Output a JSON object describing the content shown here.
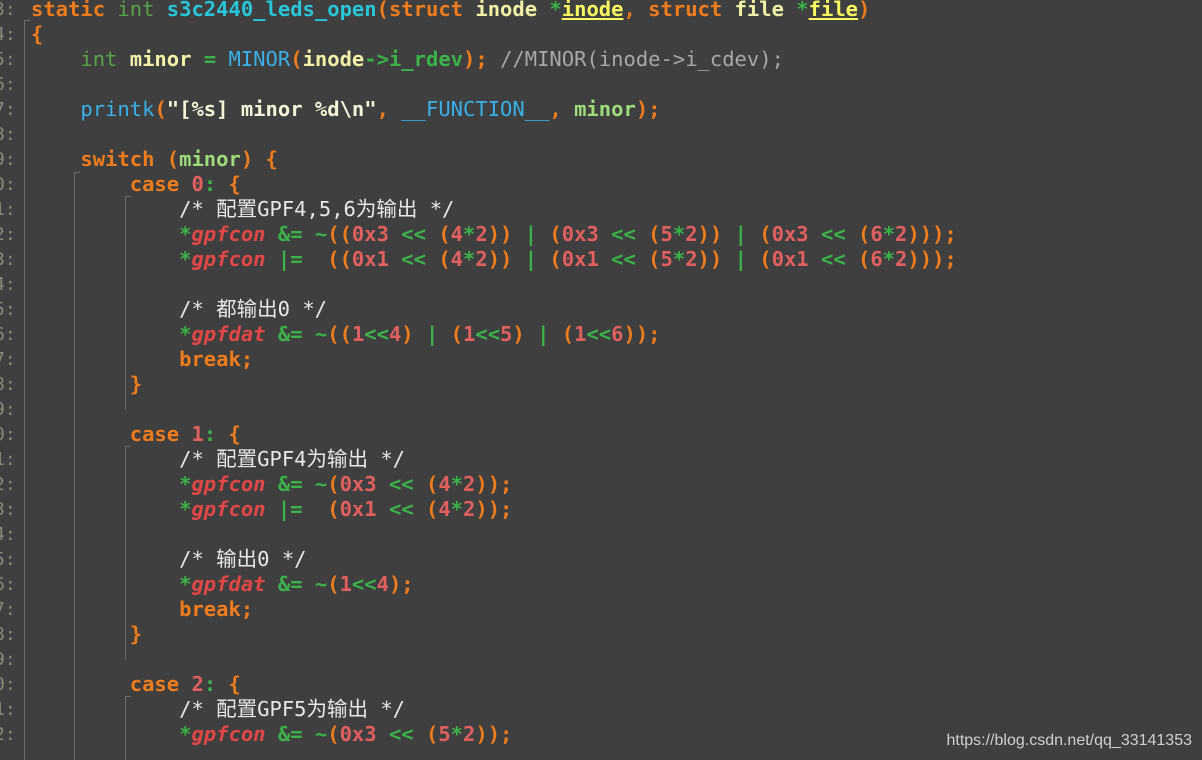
{
  "editor": {
    "line_numbers": [
      "3:",
      "4:",
      "5:",
      "6:",
      "7:",
      "8:",
      "9:",
      "0:",
      "1:",
      "2:",
      "3:",
      "4:",
      "5:",
      "6:",
      "7:",
      "8:",
      "9:",
      "0:",
      "1:",
      "2:",
      "3:",
      "4:",
      "5:",
      "6:",
      "7:",
      "8:",
      "9:",
      "0:",
      "1:",
      "2:"
    ],
    "lines": [
      [
        [
          "kw",
          "static"
        ],
        [
          "plain",
          " "
        ],
        [
          "type",
          "int"
        ],
        [
          "plain",
          " "
        ],
        [
          "fn",
          "s3c2440_leds_open"
        ],
        [
          "punc",
          "("
        ],
        [
          "kw",
          "struct"
        ],
        [
          "plain",
          " "
        ],
        [
          "ident",
          "inode"
        ],
        [
          "plain",
          " "
        ],
        [
          "green",
          "*"
        ],
        [
          "ul",
          "inode"
        ],
        [
          "punc",
          ", "
        ],
        [
          "kw",
          "struct"
        ],
        [
          "plain",
          " "
        ],
        [
          "ident",
          "file"
        ],
        [
          "plain",
          " "
        ],
        [
          "green",
          "*"
        ],
        [
          "ul",
          "file"
        ],
        [
          "punc",
          ")"
        ]
      ],
      [
        [
          "punc",
          "{"
        ]
      ],
      [
        [
          "plain",
          "    "
        ],
        [
          "type",
          "int"
        ],
        [
          "plain",
          " "
        ],
        [
          "ident",
          "minor"
        ],
        [
          "plain",
          " "
        ],
        [
          "green",
          "="
        ],
        [
          "plain",
          " "
        ],
        [
          "macro",
          "MINOR"
        ],
        [
          "punc",
          "("
        ],
        [
          "ident",
          "inode"
        ],
        [
          "green",
          "->"
        ],
        [
          "green",
          "i_rdev"
        ],
        [
          "punc",
          ");"
        ],
        [
          "plain",
          " "
        ],
        [
          "comment",
          "//MINOR(inode->i_cdev);"
        ]
      ],
      [],
      [
        [
          "plain",
          "    "
        ],
        [
          "macro",
          "printk"
        ],
        [
          "punc",
          "("
        ],
        [
          "str",
          "\"[%s] minor %d\\n\""
        ],
        [
          "punc",
          ", "
        ],
        [
          "macro",
          "__FUNCTION__"
        ],
        [
          "punc",
          ", "
        ],
        [
          "fnc",
          "minor"
        ],
        [
          "punc",
          ");"
        ]
      ],
      [],
      [
        [
          "plain",
          "    "
        ],
        [
          "kw",
          "switch"
        ],
        [
          "plain",
          " "
        ],
        [
          "punc",
          "("
        ],
        [
          "fnc",
          "minor"
        ],
        [
          "punc",
          ")"
        ],
        [
          "plain",
          " "
        ],
        [
          "punc",
          "{"
        ]
      ],
      [
        [
          "plain",
          "        "
        ],
        [
          "kw",
          "case"
        ],
        [
          "plain",
          " "
        ],
        [
          "num",
          "0"
        ],
        [
          "green",
          ":"
        ],
        [
          "plain",
          " "
        ],
        [
          "punc",
          "{"
        ]
      ],
      [
        [
          "plain",
          "            "
        ],
        [
          "comment-w",
          "/* 配置GPF4,5,6为输出 */"
        ]
      ],
      [
        [
          "plain",
          "            "
        ],
        [
          "green",
          "*"
        ],
        [
          "var",
          "gpfcon"
        ],
        [
          "plain",
          " "
        ],
        [
          "green",
          "&="
        ],
        [
          "plain",
          " "
        ],
        [
          "green",
          "~"
        ],
        [
          "punc",
          "(("
        ],
        [
          "num",
          "0x3"
        ],
        [
          "plain",
          " "
        ],
        [
          "green",
          "<<"
        ],
        [
          "plain",
          " "
        ],
        [
          "punc",
          "("
        ],
        [
          "num",
          "4"
        ],
        [
          "green",
          "*"
        ],
        [
          "num",
          "2"
        ],
        [
          "punc",
          "))"
        ],
        [
          "plain",
          " "
        ],
        [
          "green",
          "|"
        ],
        [
          "plain",
          " "
        ],
        [
          "punc",
          "("
        ],
        [
          "num",
          "0x3"
        ],
        [
          "plain",
          " "
        ],
        [
          "green",
          "<<"
        ],
        [
          "plain",
          " "
        ],
        [
          "punc",
          "("
        ],
        [
          "num",
          "5"
        ],
        [
          "green",
          "*"
        ],
        [
          "num",
          "2"
        ],
        [
          "punc",
          "))"
        ],
        [
          "plain",
          " "
        ],
        [
          "green",
          "|"
        ],
        [
          "plain",
          " "
        ],
        [
          "punc",
          "("
        ],
        [
          "num",
          "0x3"
        ],
        [
          "plain",
          " "
        ],
        [
          "green",
          "<<"
        ],
        [
          "plain",
          " "
        ],
        [
          "punc",
          "("
        ],
        [
          "num",
          "6"
        ],
        [
          "green",
          "*"
        ],
        [
          "num",
          "2"
        ],
        [
          "punc",
          ")));"
        ]
      ],
      [
        [
          "plain",
          "            "
        ],
        [
          "green",
          "*"
        ],
        [
          "var",
          "gpfcon"
        ],
        [
          "plain",
          " "
        ],
        [
          "green",
          "|="
        ],
        [
          "plain",
          "  "
        ],
        [
          "punc",
          "(("
        ],
        [
          "num",
          "0x1"
        ],
        [
          "plain",
          " "
        ],
        [
          "green",
          "<<"
        ],
        [
          "plain",
          " "
        ],
        [
          "punc",
          "("
        ],
        [
          "num",
          "4"
        ],
        [
          "green",
          "*"
        ],
        [
          "num",
          "2"
        ],
        [
          "punc",
          "))"
        ],
        [
          "plain",
          " "
        ],
        [
          "green",
          "|"
        ],
        [
          "plain",
          " "
        ],
        [
          "punc",
          "("
        ],
        [
          "num",
          "0x1"
        ],
        [
          "plain",
          " "
        ],
        [
          "green",
          "<<"
        ],
        [
          "plain",
          " "
        ],
        [
          "punc",
          "("
        ],
        [
          "num",
          "5"
        ],
        [
          "green",
          "*"
        ],
        [
          "num",
          "2"
        ],
        [
          "punc",
          "))"
        ],
        [
          "plain",
          " "
        ],
        [
          "green",
          "|"
        ],
        [
          "plain",
          " "
        ],
        [
          "punc",
          "("
        ],
        [
          "num",
          "0x1"
        ],
        [
          "plain",
          " "
        ],
        [
          "green",
          "<<"
        ],
        [
          "plain",
          " "
        ],
        [
          "punc",
          "("
        ],
        [
          "num",
          "6"
        ],
        [
          "green",
          "*"
        ],
        [
          "num",
          "2"
        ],
        [
          "punc",
          ")));"
        ]
      ],
      [],
      [
        [
          "plain",
          "            "
        ],
        [
          "comment-w",
          "/* 都输出0 */"
        ]
      ],
      [
        [
          "plain",
          "            "
        ],
        [
          "green",
          "*"
        ],
        [
          "var",
          "gpfdat"
        ],
        [
          "plain",
          " "
        ],
        [
          "green",
          "&="
        ],
        [
          "plain",
          " "
        ],
        [
          "green",
          "~"
        ],
        [
          "punc",
          "(("
        ],
        [
          "num",
          "1"
        ],
        [
          "green",
          "<<"
        ],
        [
          "num",
          "4"
        ],
        [
          "punc",
          ")"
        ],
        [
          "plain",
          " "
        ],
        [
          "green",
          "|"
        ],
        [
          "plain",
          " "
        ],
        [
          "punc",
          "("
        ],
        [
          "num",
          "1"
        ],
        [
          "green",
          "<<"
        ],
        [
          "num",
          "5"
        ],
        [
          "punc",
          ")"
        ],
        [
          "plain",
          " "
        ],
        [
          "green",
          "|"
        ],
        [
          "plain",
          " "
        ],
        [
          "punc",
          "("
        ],
        [
          "num",
          "1"
        ],
        [
          "green",
          "<<"
        ],
        [
          "num",
          "6"
        ],
        [
          "punc",
          "));"
        ]
      ],
      [
        [
          "plain",
          "            "
        ],
        [
          "kw",
          "break"
        ],
        [
          "punc",
          ";"
        ]
      ],
      [
        [
          "plain",
          "        "
        ],
        [
          "punc",
          "}"
        ]
      ],
      [],
      [
        [
          "plain",
          "        "
        ],
        [
          "kw",
          "case"
        ],
        [
          "plain",
          " "
        ],
        [
          "num",
          "1"
        ],
        [
          "green",
          ":"
        ],
        [
          "plain",
          " "
        ],
        [
          "punc",
          "{"
        ]
      ],
      [
        [
          "plain",
          "            "
        ],
        [
          "comment-w",
          "/* 配置GPF4为输出 */"
        ]
      ],
      [
        [
          "plain",
          "            "
        ],
        [
          "green",
          "*"
        ],
        [
          "var",
          "gpfcon"
        ],
        [
          "plain",
          " "
        ],
        [
          "green",
          "&="
        ],
        [
          "plain",
          " "
        ],
        [
          "green",
          "~"
        ],
        [
          "punc",
          "("
        ],
        [
          "num",
          "0x3"
        ],
        [
          "plain",
          " "
        ],
        [
          "green",
          "<<"
        ],
        [
          "plain",
          " "
        ],
        [
          "punc",
          "("
        ],
        [
          "num",
          "4"
        ],
        [
          "green",
          "*"
        ],
        [
          "num",
          "2"
        ],
        [
          "punc",
          "));"
        ]
      ],
      [
        [
          "plain",
          "            "
        ],
        [
          "green",
          "*"
        ],
        [
          "var",
          "gpfcon"
        ],
        [
          "plain",
          " "
        ],
        [
          "green",
          "|="
        ],
        [
          "plain",
          "  "
        ],
        [
          "punc",
          "("
        ],
        [
          "num",
          "0x1"
        ],
        [
          "plain",
          " "
        ],
        [
          "green",
          "<<"
        ],
        [
          "plain",
          " "
        ],
        [
          "punc",
          "("
        ],
        [
          "num",
          "4"
        ],
        [
          "green",
          "*"
        ],
        [
          "num",
          "2"
        ],
        [
          "punc",
          "));"
        ]
      ],
      [],
      [
        [
          "plain",
          "            "
        ],
        [
          "comment-w",
          "/* 输出0 */"
        ]
      ],
      [
        [
          "plain",
          "            "
        ],
        [
          "green",
          "*"
        ],
        [
          "var",
          "gpfdat"
        ],
        [
          "plain",
          " "
        ],
        [
          "green",
          "&="
        ],
        [
          "plain",
          " "
        ],
        [
          "green",
          "~"
        ],
        [
          "punc",
          "("
        ],
        [
          "num",
          "1"
        ],
        [
          "green",
          "<<"
        ],
        [
          "num",
          "4"
        ],
        [
          "punc",
          ");"
        ]
      ],
      [
        [
          "plain",
          "            "
        ],
        [
          "kw",
          "break"
        ],
        [
          "punc",
          ";"
        ]
      ],
      [
        [
          "plain",
          "        "
        ],
        [
          "punc",
          "}"
        ]
      ],
      [],
      [
        [
          "plain",
          "        "
        ],
        [
          "kw",
          "case"
        ],
        [
          "plain",
          " "
        ],
        [
          "num",
          "2"
        ],
        [
          "green",
          ":"
        ],
        [
          "plain",
          " "
        ],
        [
          "punc",
          "{"
        ]
      ],
      [
        [
          "plain",
          "            "
        ],
        [
          "comment-w",
          "/* 配置GPF5为输出 */"
        ]
      ],
      [
        [
          "plain",
          "            "
        ],
        [
          "green",
          "*"
        ],
        [
          "var",
          "gpfcon"
        ],
        [
          "plain",
          " "
        ],
        [
          "green",
          "&="
        ],
        [
          "plain",
          " "
        ],
        [
          "green",
          "~"
        ],
        [
          "punc",
          "("
        ],
        [
          "num",
          "0x3"
        ],
        [
          "plain",
          " "
        ],
        [
          "green",
          "<<"
        ],
        [
          "plain",
          " "
        ],
        [
          "punc",
          "("
        ],
        [
          "num",
          "5"
        ],
        [
          "green",
          "*"
        ],
        [
          "num",
          "2"
        ],
        [
          "punc",
          "));"
        ]
      ]
    ]
  },
  "watermark": "https://blog.csdn.net/qq_33141353"
}
